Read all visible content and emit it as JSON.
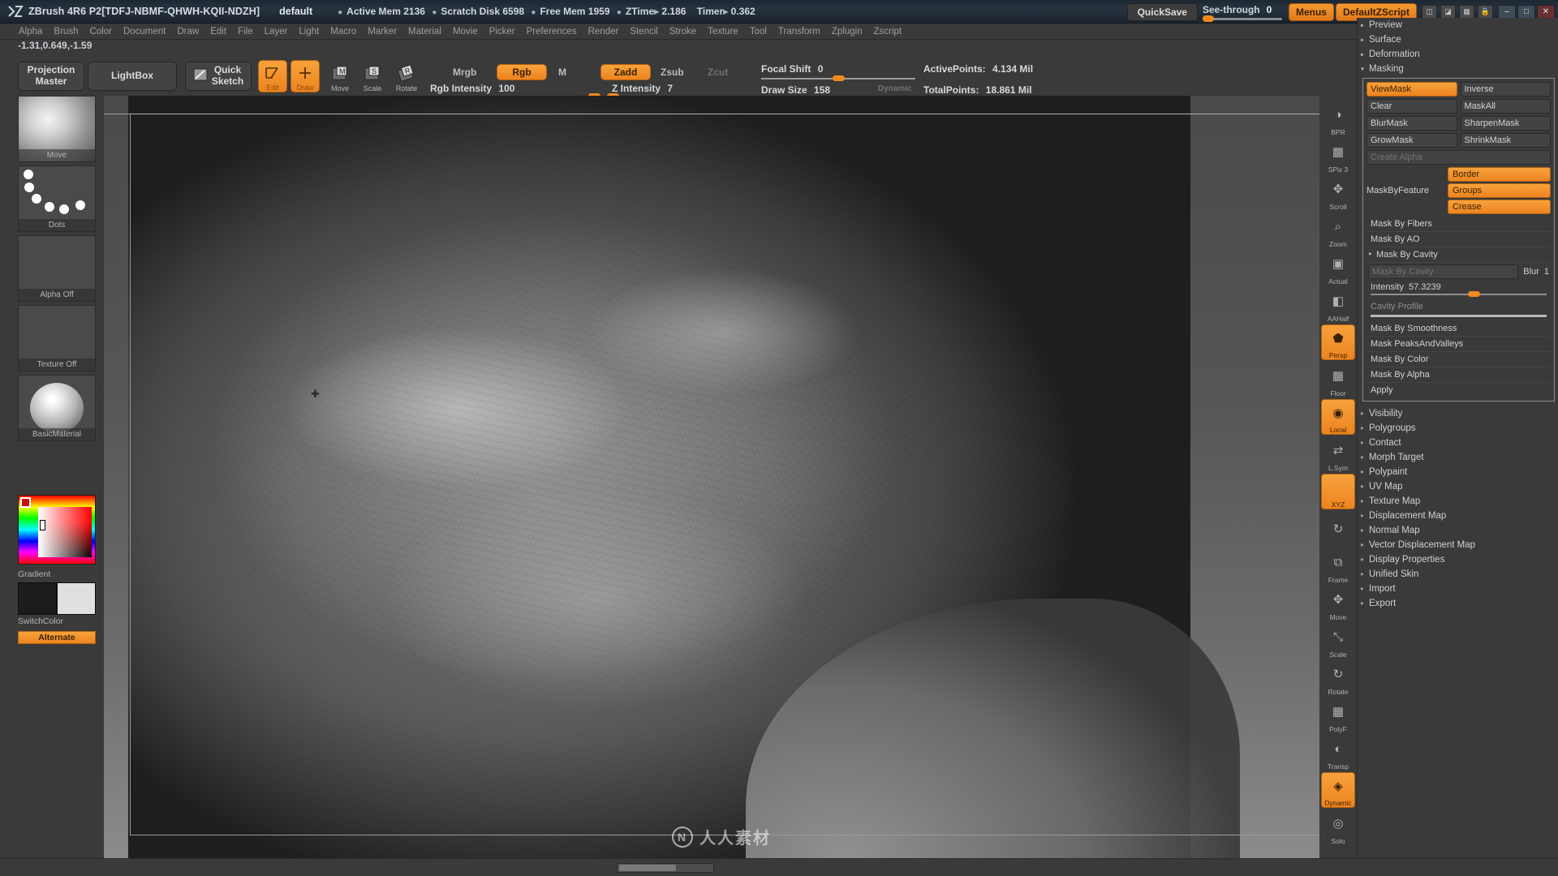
{
  "titlebar": {
    "logo_icon": "zbrush-logo-icon",
    "app_title": "ZBrush 4R6 P2[TDFJ-NBMF-QHWH-KQII-NDZH]",
    "document_name": "default",
    "stats": [
      {
        "label": "Active Mem",
        "value": "2136"
      },
      {
        "label": "Scratch Disk",
        "value": "6598"
      },
      {
        "label": "Free Mem",
        "value": "1959"
      }
    ],
    "ztime_label": "ZTime",
    "ztime_value": "2.186",
    "timer_label": "Timer",
    "timer_value": "0.362",
    "quicksave_label": "QuickSave",
    "see_through_label": "See-through",
    "see_through_value": "0",
    "menus_label": "Menus",
    "zscript_label": "DefaultZScript",
    "window_minimize": "–",
    "window_maximize": "□",
    "window_close": "✕"
  },
  "menubar": {
    "items": [
      "Alpha",
      "Brush",
      "Color",
      "Document",
      "Draw",
      "Edit",
      "File",
      "Layer",
      "Light",
      "Macro",
      "Marker",
      "Material",
      "Movie",
      "Picker",
      "Preferences",
      "Render",
      "Stencil",
      "Stroke",
      "Texture",
      "Tool",
      "Transform",
      "Zplugin",
      "Zscript"
    ]
  },
  "coords": "-1.31,0.649,-1.59",
  "toolbar": {
    "projection_master": "Projection\nMaster",
    "projection_master_line1": "Projection",
    "projection_master_line2": "Master",
    "lightbox": "LightBox",
    "quick_sketch_line1": "Quick",
    "quick_sketch_line2": "Sketch",
    "edit_label": "Edit",
    "draw_label": "Draw",
    "move_label": "Move",
    "scale_label": "Scale",
    "rotate_label": "Rotate",
    "mrgb": "Mrgb",
    "rgb": "Rgb",
    "m": "M",
    "zadd": "Zadd",
    "zsub": "Zsub",
    "zcut": "Zcut",
    "rgb_intensity_label": "Rgb Intensity",
    "rgb_intensity_value": "100",
    "z_intensity_label": "Z Intensity",
    "z_intensity_value": "7",
    "focal_shift_label": "Focal Shift",
    "focal_shift_value": "0",
    "draw_size_label": "Draw Size",
    "draw_size_value": "158",
    "dynamic_label": "Dynamic",
    "active_points_label": "ActivePoints:",
    "active_points_value": "4.134 Mil",
    "total_points_label": "TotalPoints:",
    "total_points_value": "18.861 Mil"
  },
  "left_shelf": {
    "brush_label": "Move",
    "stroke_label": "Dots",
    "alpha_label": "Alpha Off",
    "texture_label": "Texture Off",
    "material_label": "BasicMaterial",
    "gradient_label": "Gradient",
    "switch_color_label": "SwitchColor",
    "alternate_label": "Alternate"
  },
  "right_tools": [
    {
      "label": "BPR",
      "icon": "bpr-render-icon",
      "active": false
    },
    {
      "label": "SPix 3",
      "icon": "spix-icon",
      "active": false
    },
    {
      "label": "Scroll",
      "icon": "scroll-icon",
      "active": false
    },
    {
      "label": "Zoom",
      "icon": "zoom-icon",
      "active": false
    },
    {
      "label": "Actual",
      "icon": "actual-size-icon",
      "active": false
    },
    {
      "label": "AAHalf",
      "icon": "aa-half-icon",
      "active": false
    },
    {
      "label": "Persp",
      "icon": "perspective-icon",
      "active": true
    },
    {
      "label": "Floor",
      "icon": "floor-grid-icon",
      "active": false
    },
    {
      "label": "Local",
      "icon": "local-transform-icon",
      "active": true
    },
    {
      "label": "L.Sym",
      "icon": "local-symmetry-icon",
      "active": false
    },
    {
      "label": "XYZ",
      "icon": "xyz-axis-icon",
      "active": true
    },
    {
      "label": "",
      "icon": "rotate-arrow-icon",
      "active": false
    },
    {
      "label": "Frame",
      "icon": "frame-icon",
      "active": false
    },
    {
      "label": "Move",
      "icon": "move-icon",
      "active": false
    },
    {
      "label": "Scale",
      "icon": "scale-icon",
      "active": false
    },
    {
      "label": "Rotate",
      "icon": "rotate-icon",
      "active": false
    },
    {
      "label": "PolyF",
      "icon": "polyframe-icon",
      "active": false
    },
    {
      "label": "Transp",
      "icon": "transparency-icon",
      "active": false
    },
    {
      "label": "Dynamic",
      "icon": "dynamic-icon",
      "active": true
    },
    {
      "label": "Solo",
      "icon": "solo-icon",
      "active": false
    },
    {
      "label": "",
      "icon": "grid-icon",
      "active": false
    }
  ],
  "right_panel": {
    "top_sections": [
      "Preview",
      "Surface",
      "Deformation"
    ],
    "masking": {
      "title": "Masking",
      "view_mask": "ViewMask",
      "inverse": "Inverse",
      "clear": "Clear",
      "mask_all": "MaskAll",
      "blur_mask": "BlurMask",
      "sharpen_mask": "SharpenMask",
      "grow_mask": "GrowMask",
      "shrink_mask": "ShrinkMask",
      "create_alpha": "Create Alpha",
      "mask_by_feature_label": "MaskByFeature",
      "border": "Border",
      "groups": "Groups",
      "crease": "Crease",
      "mask_by_fibers": "Mask By Fibers",
      "mask_by_ao": "Mask By AO",
      "mask_by_cavity_section": "Mask By Cavity",
      "mask_by_cavity_btn": "Mask By Cavity",
      "blur_label": "Blur",
      "blur_value": "1",
      "intensity_label": "Intensity",
      "intensity_value": "57.3239",
      "cavity_profile": "Cavity Profile",
      "mask_by_smoothness": "Mask By Smoothness",
      "mask_peaks_and_valleys": "Mask PeaksAndValleys",
      "mask_by_color": "Mask By Color",
      "mask_by_alpha": "Mask By Alpha",
      "apply": "Apply"
    },
    "sections": [
      "Visibility",
      "Polygroups",
      "Contact",
      "Morph Target",
      "Polypaint",
      "UV Map",
      "Texture Map",
      "Displacement Map",
      "Normal Map",
      "Vector Displacement Map",
      "Display Properties",
      "Unified Skin",
      "Import",
      "Export"
    ]
  },
  "watermark": "人人素材"
}
